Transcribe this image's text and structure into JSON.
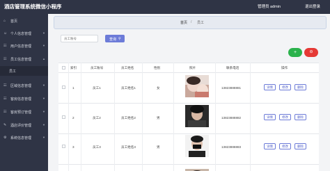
{
  "app": {
    "title": "酒店管理系统微信小程序",
    "admin_label": "管理员 admin",
    "logout_label": "退出登录"
  },
  "sidebar": {
    "items": [
      {
        "icon": "home-icon",
        "label": "首页",
        "glyph": "⌂"
      },
      {
        "icon": "user-icon",
        "label": "个人信息管理",
        "glyph": "☺"
      },
      {
        "icon": "users-icon",
        "label": "用户信息管理",
        "glyph": "☷"
      },
      {
        "icon": "staff-icon",
        "label": "员工信息管理",
        "glyph": "☷"
      },
      {
        "icon": "area-icon",
        "label": "区域信息管理",
        "glyph": "☷"
      },
      {
        "icon": "room-icon",
        "label": "客房信息管理",
        "glyph": "☷"
      },
      {
        "icon": "booking-icon",
        "label": "客房预订管理",
        "glyph": "☷"
      },
      {
        "icon": "review-icon",
        "label": "酒店评价管理",
        "glyph": "✎"
      },
      {
        "icon": "system-icon",
        "label": "系统信息管理",
        "glyph": "⚙"
      }
    ],
    "sub_item": "员工"
  },
  "breadcrumb": {
    "home": "首页",
    "sep": "/",
    "current": "员工"
  },
  "search": {
    "placeholder": "员工账号",
    "button_label": "查询"
  },
  "actions": {
    "add_glyph": "+",
    "delete_glyph": "⊖"
  },
  "table": {
    "headers": [
      "索引",
      "员工账号",
      "员工姓名",
      "性别",
      "照片",
      "联系电话",
      "操作"
    ],
    "rows": [
      {
        "index": "1",
        "account": "员工1",
        "name": "员工姓名1",
        "gender": "女",
        "phone": "13823888881"
      },
      {
        "index": "2",
        "account": "员工2",
        "name": "员工姓名2",
        "gender": "男",
        "phone": "13823888882"
      },
      {
        "index": "3",
        "account": "员工3",
        "name": "员工姓名3",
        "gender": "男",
        "phone": "13823888883"
      }
    ],
    "op_labels": {
      "detail": "详情",
      "edit": "修改",
      "delete": "删除"
    }
  },
  "colors": {
    "sidebar_bg": "#2f3445",
    "primary": "#6c7bd8",
    "add": "#2bb24c",
    "danger": "#e53935"
  }
}
